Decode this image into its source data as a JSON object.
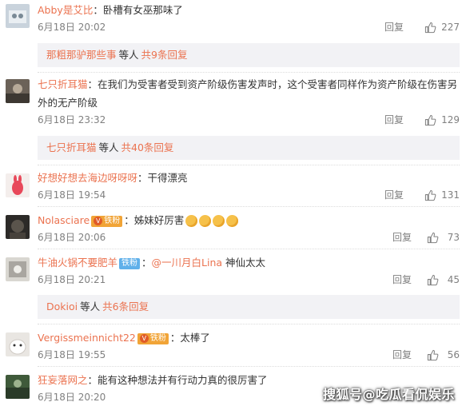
{
  "reply_label": "回复",
  "comments": [
    {
      "name": "Abby是艾比",
      "text": "卧槽有女巫那味了",
      "time": "6月18日 20:02",
      "likes": "227"
    },
    {
      "name": "七只折耳猫",
      "text": "在我们为受害者受到资产阶级伤害发声时，这个受害者同样作为资产阶级在伤害另外的无产阶级",
      "time": "6月18日 23:32",
      "likes": "129"
    },
    {
      "name": "好想好想去海边呀呀呀",
      "text": "干得漂亮",
      "time": "6月18日 19:54",
      "likes": "131"
    },
    {
      "name": "Nolasciare",
      "badge": "铁粉",
      "text": "姊妹好厉害",
      "time": "6月18日 20:06",
      "likes": "73"
    },
    {
      "name": "牛油火锅不要肥羊",
      "badge": "铁粉",
      "mention": "@一川月白Lina",
      "text": "神仙太太",
      "time": "6月18日 20:21",
      "likes": "45"
    },
    {
      "name": "Vergissmeinnicht22",
      "badge": "铁粉",
      "text": "太棒了",
      "time": "6月18日 19:55",
      "likes": "56"
    },
    {
      "name": "狂妄落网之",
      "text": "能有这种想法并有行动力真的很厉害了",
      "time": "6月18日 20:20",
      "likes": ""
    }
  ],
  "sub_replies": [
    {
      "name": "那粗那驴那些事",
      "word": "等人",
      "count": "共9条回复"
    },
    {
      "name": "七只折耳猫",
      "word": "等人",
      "count": "共40条回复"
    },
    {
      "name": "Dokioi",
      "word": "等人",
      "count": "共6条回复"
    }
  ],
  "watermark": "搜狐号@吃瓜看侃娱乐",
  "colors": {
    "name": "#eb7350",
    "text": "#333333",
    "meta": "#808080",
    "sub_bg": "#f2f2f5",
    "badge_orange": "#f1a437",
    "badge_blue": "#5fb0ea"
  }
}
